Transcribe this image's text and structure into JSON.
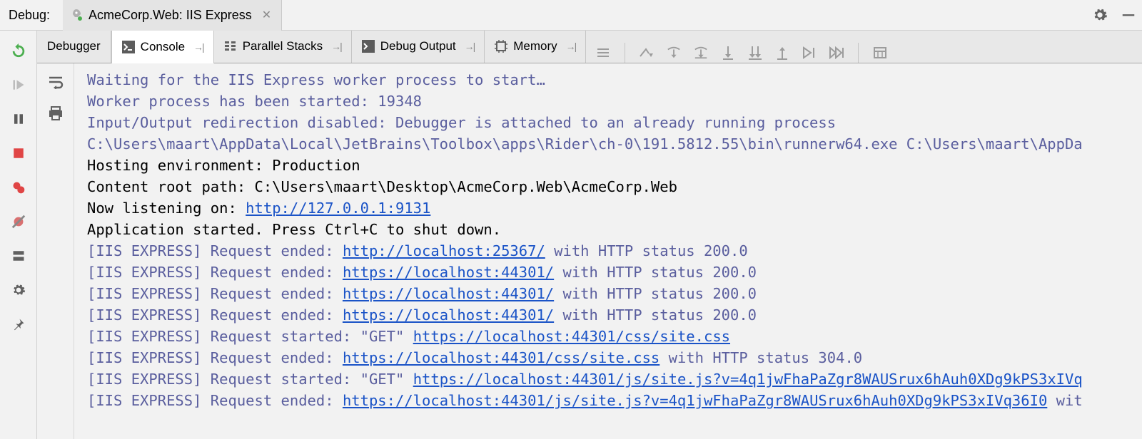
{
  "topbar": {
    "debug_label": "Debug:",
    "config_name": "AcmeCorp.Web: IIS Express"
  },
  "tabs": {
    "debugger": "Debugger",
    "console": "Console",
    "parallel": "Parallel Stacks",
    "debug_output": "Debug Output",
    "memory": "Memory"
  },
  "console": {
    "l1": "Waiting for the IIS Express worker process to start…",
    "l2": "Worker process has been started: 19348",
    "l3": "Input/Output redirection disabled: Debugger is attached to an already running process",
    "l4": "C:\\Users\\maart\\AppData\\Local\\JetBrains\\Toolbox\\apps\\Rider\\ch-0\\191.5812.55\\bin\\runnerw64.exe C:\\Users\\maart\\AppDa",
    "l5": "Hosting environment: Production",
    "l6": "Content root path: C:\\Users\\maart\\Desktop\\AcmeCorp.Web\\AcmeCorp.Web",
    "l7a": "Now listening on: ",
    "l7url": "http://127.0.0.1:9131",
    "l8": "Application started. Press Ctrl+C to shut down.",
    "req_ended": " Request ended: ",
    "req_started": " Request started: ",
    "get": "\"GET\" ",
    "tag": "[IIS EXPRESS]",
    "tail200": " with HTTP status 200.0",
    "tail304": " with HTTP status 304.0",
    "tailwit": " wit",
    "u1": "http://localhost:25367/",
    "u2": "https://localhost:44301/",
    "u3": "https://localhost:44301/css/site.css",
    "u4": "https://localhost:44301/js/site.js?v=4q1jwFhaPaZgr8WAUSrux6hAuh0XDg9kPS3xIVq",
    "u5": "https://localhost:44301/js/site.js?v=4q1jwFhaPaZgr8WAUSrux6hAuh0XDg9kPS3xIVq36I0"
  }
}
